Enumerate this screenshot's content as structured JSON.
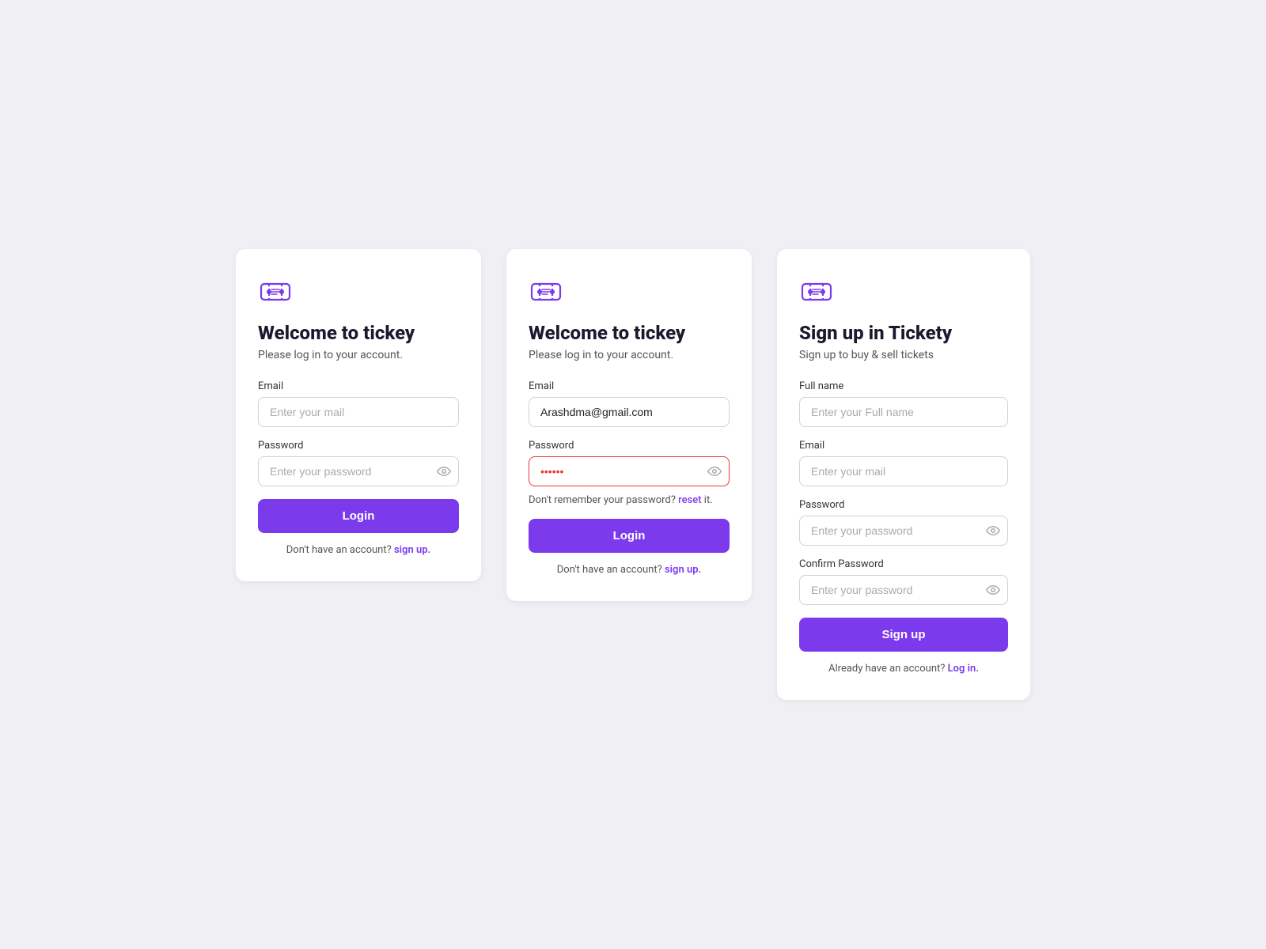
{
  "cards": [
    {
      "id": "login-clean",
      "icon": "ticket",
      "title": "Welcome to tickey",
      "subtitle": "Please log in to your account.",
      "fields": [
        {
          "id": "email-clean",
          "label": "Email",
          "type": "text",
          "placeholder": "Enter your mail",
          "value": "",
          "has_eye": false,
          "error": false
        },
        {
          "id": "password-clean",
          "label": "Password",
          "type": "password",
          "placeholder": "Enter your password",
          "value": "",
          "has_eye": true,
          "error": false
        }
      ],
      "forgot": null,
      "button_label": "Login",
      "footer_text": "Don't have an account?",
      "footer_link_label": "sign up.",
      "footer_link_href": "#"
    },
    {
      "id": "login-error",
      "icon": "ticket",
      "title": "Welcome to tickey",
      "subtitle": "Please log in to your account.",
      "fields": [
        {
          "id": "email-error",
          "label": "Email",
          "type": "text",
          "placeholder": "Enter your mail",
          "value": "Arashdma@gmail.com",
          "has_eye": false,
          "error": false
        },
        {
          "id": "password-error",
          "label": "Password",
          "type": "password",
          "placeholder": "Enter your password",
          "value": "••••••",
          "has_eye": true,
          "error": true
        }
      ],
      "forgot": {
        "prefix": "Don't remember your password?",
        "link_label": "reset",
        "suffix": "it."
      },
      "button_label": "Login",
      "footer_text": "Don't have an account?",
      "footer_link_label": "sign up.",
      "footer_link_href": "#"
    },
    {
      "id": "signup",
      "icon": "ticket",
      "title": "Sign up in Tickety",
      "subtitle": "Sign up to buy & sell tickets",
      "fields": [
        {
          "id": "fullname",
          "label": "Full name",
          "type": "text",
          "placeholder": "Enter your Full name",
          "value": "",
          "has_eye": false,
          "error": false
        },
        {
          "id": "email-signup",
          "label": "Email",
          "type": "text",
          "placeholder": "Enter your mail",
          "value": "",
          "has_eye": false,
          "error": false
        },
        {
          "id": "password-signup",
          "label": "Password",
          "type": "password",
          "placeholder": "Enter your password",
          "value": "",
          "has_eye": true,
          "error": false
        },
        {
          "id": "confirm-password",
          "label": "Confirm Password",
          "type": "password",
          "placeholder": "Enter your password",
          "value": "",
          "has_eye": true,
          "error": false
        }
      ],
      "forgot": null,
      "button_label": "Sign up",
      "footer_text": "Already have an account?",
      "footer_link_label": "Log in.",
      "footer_link_href": "#"
    }
  ],
  "eye_icon": "👁",
  "accent_color": "#7c3aed",
  "error_color": "#e53935"
}
